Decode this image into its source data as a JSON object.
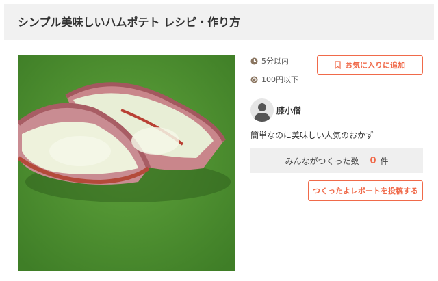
{
  "recipe": {
    "title": "シンプル美味しいハムポテト レシピ・作り方",
    "time": "5分以内",
    "cost": "100円以下",
    "favorite_button_label": "お気に入りに追加",
    "author_name": "膝小僧",
    "description": "簡単なのに美味しい人気のおかず",
    "made_label": "みんながつくった数",
    "made_count": "0",
    "made_unit": "件",
    "report_button_label": "つくったよレポートを投稿する"
  },
  "icons": {
    "time": "clock-icon",
    "cost": "coin-icon",
    "favorite": "bookmark-icon",
    "author": "user-avatar-icon"
  },
  "colors": {
    "accent": "#f06a4a",
    "title_bar_bg": "#f1f1f1",
    "made_box_bg": "#efefef"
  }
}
